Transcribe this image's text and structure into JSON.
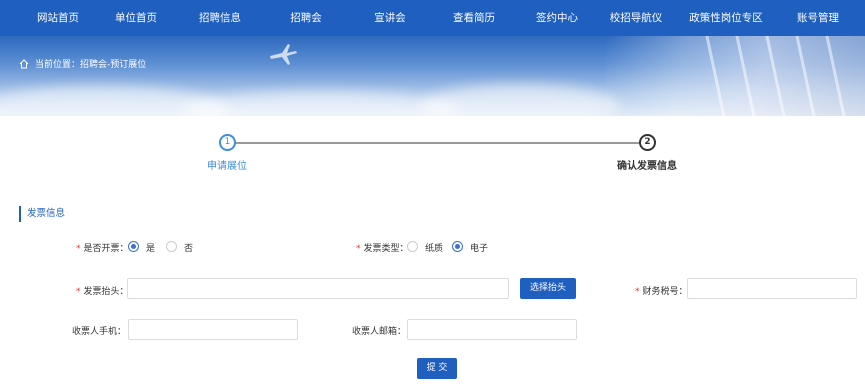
{
  "nav": {
    "items": [
      "网站首页",
      "单位首页",
      "招聘信息",
      "招聘会",
      "宣讲会",
      "查看简历",
      "签约中心",
      "校招导航仪",
      "政策性岗位专区",
      "账号管理"
    ]
  },
  "breadcrumb": {
    "icon": "home-icon",
    "text": "当前位置：招聘会-预订展位"
  },
  "steps": [
    {
      "number": "1",
      "label": "申请展位",
      "state": "completed"
    },
    {
      "number": "2",
      "label": "确认发票信息",
      "state": "current"
    }
  ],
  "section": {
    "title": "发票信息"
  },
  "form": {
    "invoice_needed": {
      "label": "是否开票：",
      "options": [
        "是",
        "否"
      ],
      "selected": "是"
    },
    "invoice_type": {
      "label": "发票类型：",
      "options": [
        "纸质",
        "电子"
      ],
      "selected": "电子"
    },
    "invoice_title": {
      "label": "发票抬头：",
      "value": "",
      "button": "选择抬头"
    },
    "tax_number": {
      "label": "财务税号：",
      "value": ""
    },
    "receiver_phone": {
      "label": "收票人手机：",
      "value": ""
    },
    "receiver_email": {
      "label": "收票人邮箱：",
      "value": ""
    },
    "submit": "提 交"
  },
  "colors": {
    "primary": "#1f5fbf",
    "step_active": "#3d8de0",
    "required": "#ee3333"
  }
}
